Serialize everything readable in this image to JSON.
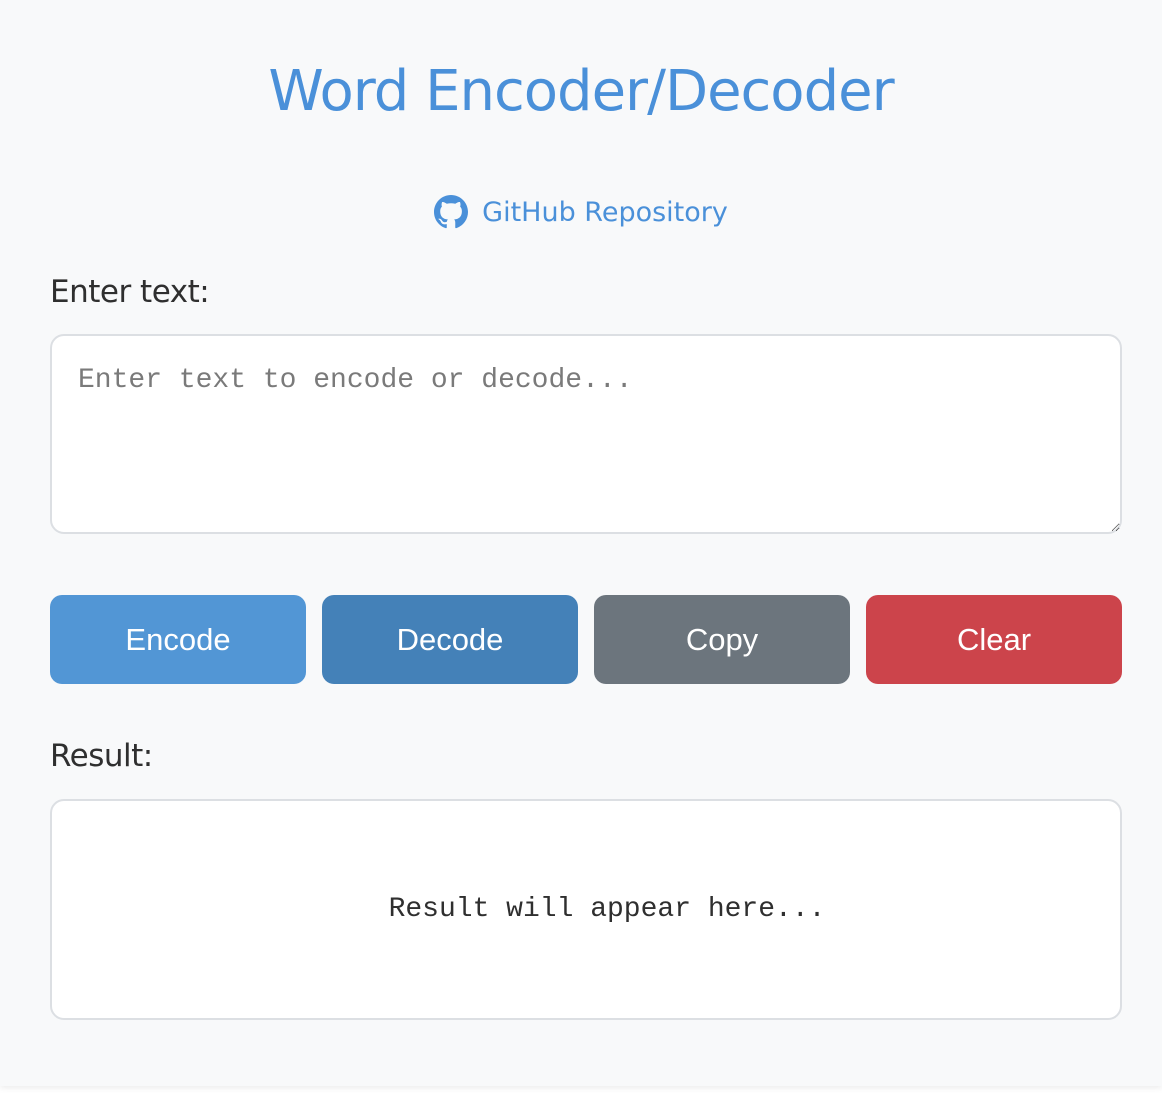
{
  "header": {
    "title": "Word Encoder/Decoder",
    "repo_link_label": "GitHub Repository",
    "repo_icon": "github-icon"
  },
  "input": {
    "label": "Enter text:",
    "value": "",
    "placeholder": "Enter text to encode or decode..."
  },
  "actions": {
    "encode_label": "Encode",
    "decode_label": "Decode",
    "copy_label": "Copy",
    "clear_label": "Clear"
  },
  "result": {
    "label": "Result:",
    "placeholder_text": "Result will appear here..."
  },
  "colors": {
    "accent": "#4a90d9",
    "encode": "#5296d5",
    "decode": "#4481b8",
    "copy": "#6c757d",
    "clear": "#cc444b",
    "background": "#f8f9fa"
  }
}
